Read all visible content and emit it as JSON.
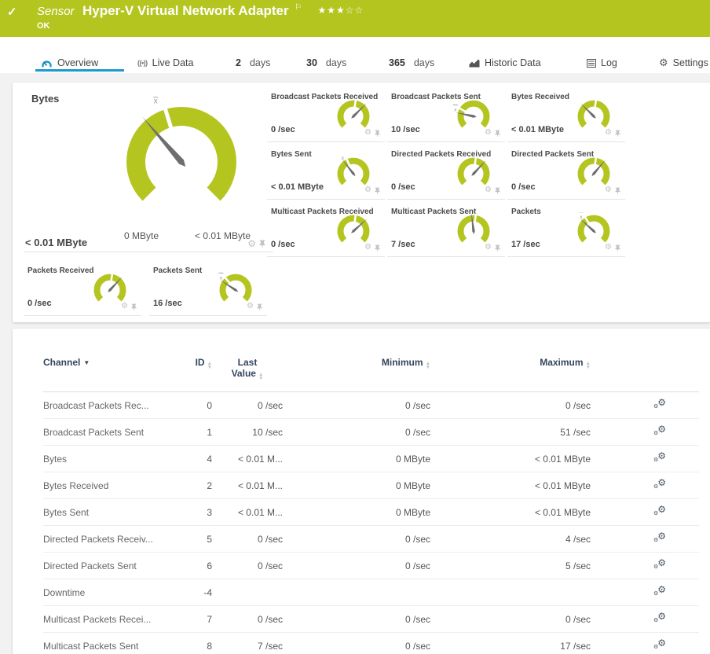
{
  "colors": {
    "accent_green": "#b5c520",
    "accent_blue": "#1b9ad2",
    "needle_gray": "#6e6e6e",
    "header_text": "#33455e"
  },
  "icons": {
    "check": "✓",
    "flag": "⚐",
    "stars": "★★★☆☆",
    "gear": "⚙",
    "sort_up": "▲",
    "sort_down": "▼",
    "caret_down": "▼",
    "broadcast": "((•))"
  },
  "banner": {
    "kind": "Sensor",
    "title": "Hyper-V Virtual Network Adapter",
    "status": "OK"
  },
  "tabs": {
    "overview": "Overview",
    "live_data": "Live Data",
    "d2_num": "2",
    "d2_word": "days",
    "d30_num": "30",
    "d30_word": "days",
    "d365_num": "365",
    "d365_word": "days",
    "historic": "Historic Data",
    "log": "Log",
    "settings": "Settings"
  },
  "gauges": {
    "main": {
      "title": "Bytes",
      "value": "< 0.01 MByte",
      "scale_min": "0 MByte",
      "scale_max": "< 0.01 MByte",
      "needle_deg": 131,
      "notch_deg": 107
    },
    "small": [
      {
        "title": "Broadcast Packets Received",
        "value": "0 /sec",
        "needle_deg": 45,
        "notch_deg": 82
      },
      {
        "title": "Broadcast Packets Sent",
        "value": "10 /sec",
        "needle_deg": 168,
        "notch_deg": 150,
        "avg_marker": true
      },
      {
        "title": "Bytes Received",
        "value": "< 0.01 MByte",
        "needle_deg": 135,
        "notch_deg": 82
      },
      {
        "title": "Bytes Sent",
        "value": "< 0.01 MByte",
        "needle_deg": 128,
        "notch_deg": 115,
        "avg_marker": true
      },
      {
        "title": "Directed Packets Received",
        "value": "0 /sec",
        "needle_deg": 47,
        "notch_deg": 82
      },
      {
        "title": "Directed Packets Sent",
        "value": "0 /sec",
        "needle_deg": 50,
        "notch_deg": 82
      },
      {
        "title": "Multicast Packets Received",
        "value": "0 /sec",
        "needle_deg": 42,
        "notch_deg": 82
      },
      {
        "title": "Multicast Packets Sent",
        "value": "7 /sec",
        "needle_deg": 97,
        "notch_deg": 82
      },
      {
        "title": "Packets",
        "value": "17 /sec",
        "needle_deg": 138,
        "notch_deg": 122,
        "avg_marker": true
      },
      {
        "title": "Packets Received",
        "value": "0 /sec",
        "needle_deg": 47,
        "notch_deg": 82
      },
      {
        "title": "Packets Sent",
        "value": "16 /sec",
        "needle_deg": 147,
        "notch_deg": 130,
        "avg_marker": true
      }
    ]
  },
  "table": {
    "headers": {
      "channel": "Channel",
      "id": "ID",
      "last1": "Last",
      "last2": "Value",
      "min": "Minimum",
      "max": "Maximum"
    },
    "rows": [
      {
        "name": "Broadcast Packets Rec...",
        "id": "0",
        "last": "0 /sec",
        "min": "0 /sec",
        "max": "0 /sec"
      },
      {
        "name": "Broadcast Packets Sent",
        "id": "1",
        "last": "10 /sec",
        "min": "0 /sec",
        "max": "51 /sec"
      },
      {
        "name": "Bytes",
        "id": "4",
        "last": "< 0.01 M...",
        "min": "0 MByte",
        "max": "< 0.01 MByte"
      },
      {
        "name": "Bytes Received",
        "id": "2",
        "last": "< 0.01 M...",
        "min": "0 MByte",
        "max": "< 0.01 MByte"
      },
      {
        "name": "Bytes Sent",
        "id": "3",
        "last": "< 0.01 M...",
        "min": "0 MByte",
        "max": "< 0.01 MByte"
      },
      {
        "name": "Directed Packets Receiv...",
        "id": "5",
        "last": "0 /sec",
        "min": "0 /sec",
        "max": "4 /sec"
      },
      {
        "name": "Directed Packets Sent",
        "id": "6",
        "last": "0 /sec",
        "min": "0 /sec",
        "max": "5 /sec"
      },
      {
        "name": "Downtime",
        "id": "-4",
        "last": "",
        "min": "",
        "max": ""
      },
      {
        "name": "Multicast Packets Recei...",
        "id": "7",
        "last": "0 /sec",
        "min": "0 /sec",
        "max": "0 /sec"
      },
      {
        "name": "Multicast Packets Sent",
        "id": "8",
        "last": "7 /sec",
        "min": "0 /sec",
        "max": "17 /sec"
      }
    ]
  }
}
